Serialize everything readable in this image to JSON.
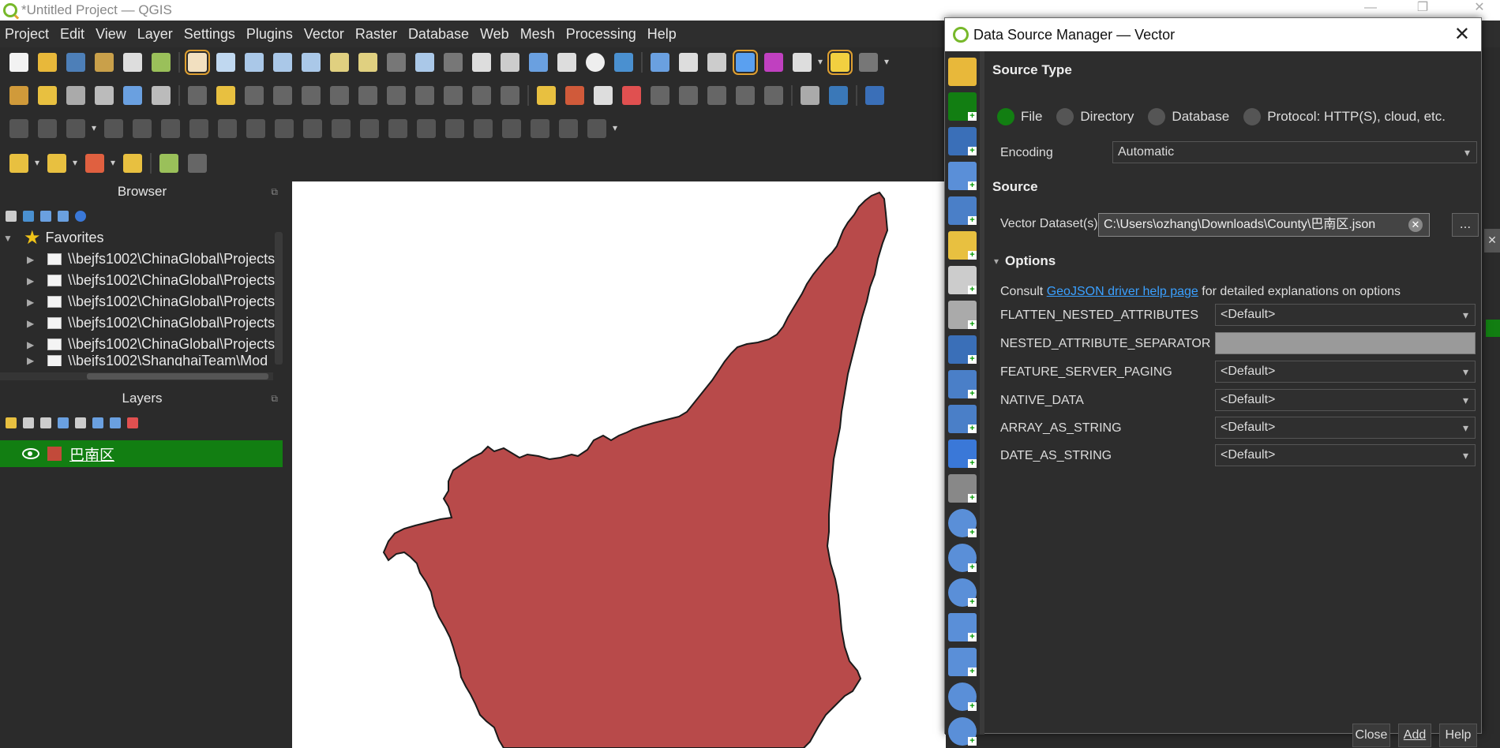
{
  "window": {
    "title": "*Untitled Project — QGIS"
  },
  "menu": [
    "Project",
    "Edit",
    "View",
    "Layer",
    "Settings",
    "Plugins",
    "Vector",
    "Raster",
    "Database",
    "Web",
    "Mesh",
    "Processing",
    "Help"
  ],
  "browser": {
    "title": "Browser",
    "favorites_label": "Favorites",
    "items": [
      "\\\\bejfs1002\\ChinaGlobal\\Projects",
      "\\\\bejfs1002\\ChinaGlobal\\Projects",
      "\\\\bejfs1002\\ChinaGlobal\\Projects",
      "\\\\bejfs1002\\ChinaGlobal\\Projects",
      "\\\\bejfs1002\\ChinaGlobal\\Projects",
      "\\\\bejfs1002\\ShanghaiTeam\\Mod"
    ]
  },
  "layers": {
    "title": "Layers",
    "items": [
      {
        "name": "巴南区",
        "color": "#c24a3a"
      }
    ]
  },
  "map": {
    "fill_color": "#b84a4a",
    "stroke_color": "#1a1a1a"
  },
  "dialog": {
    "title": "Data Source Manager — Vector",
    "source_type_heading": "Source Type",
    "radio_options": [
      "File",
      "Directory",
      "Database",
      "Protocol: HTTP(S), cloud, etc."
    ],
    "selected_option": "File",
    "encoding_label": "Encoding",
    "encoding_value": "Automatic",
    "source_heading": "Source",
    "dataset_label": "Vector Dataset(s)",
    "dataset_value": "C:\\Users\\ozhang\\Downloads\\County\\巴南区.json",
    "browse_label": "...",
    "options_heading": "Options",
    "consult_prefix": "Consult",
    "consult_link": "GeoJSON driver help page",
    "consult_suffix": "for detailed explanations on options",
    "options": [
      {
        "label": "FLATTEN_NESTED_ATTRIBUTES",
        "value": "<Default>",
        "kind": "combo"
      },
      {
        "label": "NESTED_ATTRIBUTE_SEPARATOR",
        "value": "",
        "kind": "text"
      },
      {
        "label": "FEATURE_SERVER_PAGING",
        "value": "<Default>",
        "kind": "combo"
      },
      {
        "label": "NATIVE_DATA",
        "value": "<Default>",
        "kind": "combo"
      },
      {
        "label": "ARRAY_AS_STRING",
        "value": "<Default>",
        "kind": "combo"
      },
      {
        "label": "DATE_AS_STRING",
        "value": "<Default>",
        "kind": "combo"
      }
    ],
    "buttons": {
      "close": "Close",
      "add": "Add",
      "help": "Help"
    },
    "accent_color": "#127e12"
  }
}
